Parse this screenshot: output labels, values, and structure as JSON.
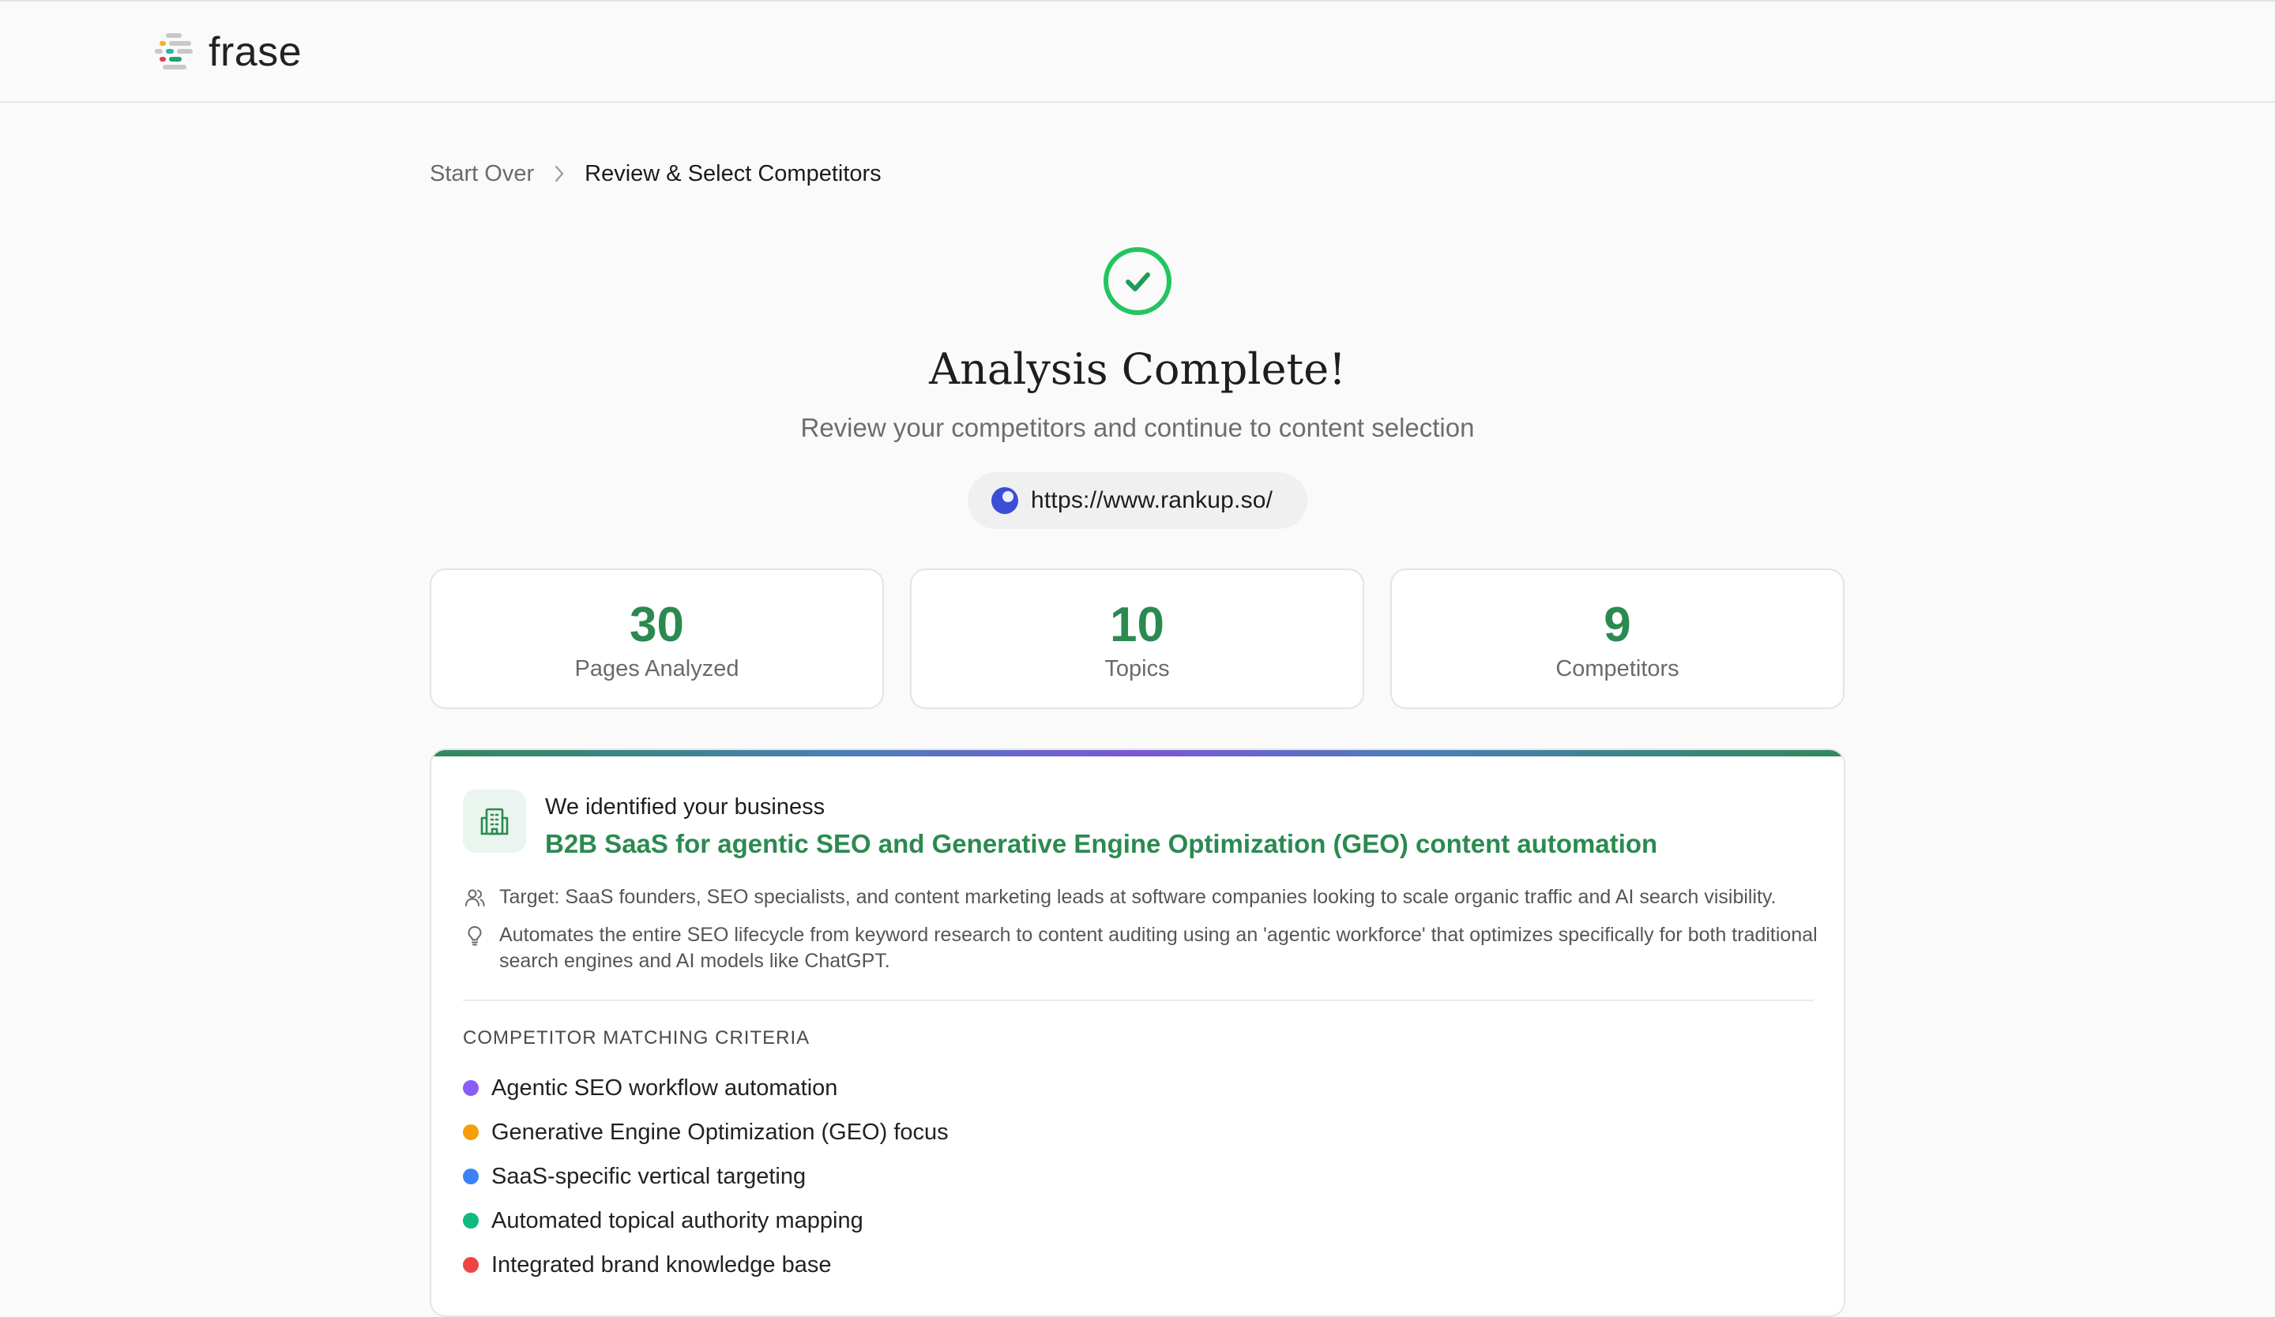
{
  "brand": {
    "name": "frase",
    "logo_colors": [
      "#f2b01e",
      "#2bb3a3",
      "#1fa36b",
      "#e63d57",
      "#c8c8c8"
    ]
  },
  "breadcrumb": {
    "start_over": "Start Over",
    "current": "Review & Select Competitors"
  },
  "hero": {
    "title": "Analysis Complete!",
    "subtitle": "Review your competitors and continue to content selection",
    "url": "https://www.rankup.so/"
  },
  "stats": [
    {
      "value": "30",
      "label": "Pages Analyzed"
    },
    {
      "value": "10",
      "label": "Topics"
    },
    {
      "value": "9",
      "label": "Competitors"
    }
  ],
  "business": {
    "heading": "We identified your business",
    "name": "B2B SaaS for agentic SEO and Generative Engine Optimization (GEO) content automation",
    "target": "Target: SaaS founders, SEO specialists, and content marketing leads at software companies looking to scale organic traffic and AI search visibility.",
    "description": "Automates the entire SEO lifecycle from keyword research to content auditing using an 'agentic workforce' that optimizes specifically for both traditional search engines and AI models like ChatGPT."
  },
  "criteria": {
    "label": "COMPETITOR MATCHING CRITERIA",
    "items": [
      {
        "text": "Agentic SEO workflow automation",
        "color": "#8b5cf6"
      },
      {
        "text": "Generative Engine Optimization (GEO) focus",
        "color": "#f59e0b"
      },
      {
        "text": "SaaS-specific vertical targeting",
        "color": "#3b82f6"
      },
      {
        "text": "Automated topical authority mapping",
        "color": "#10b981"
      },
      {
        "text": "Integrated brand knowledge base",
        "color": "#ef4444"
      }
    ]
  },
  "colors": {
    "accent_green": "#2b8a4f",
    "check_green": "#22c55e"
  }
}
